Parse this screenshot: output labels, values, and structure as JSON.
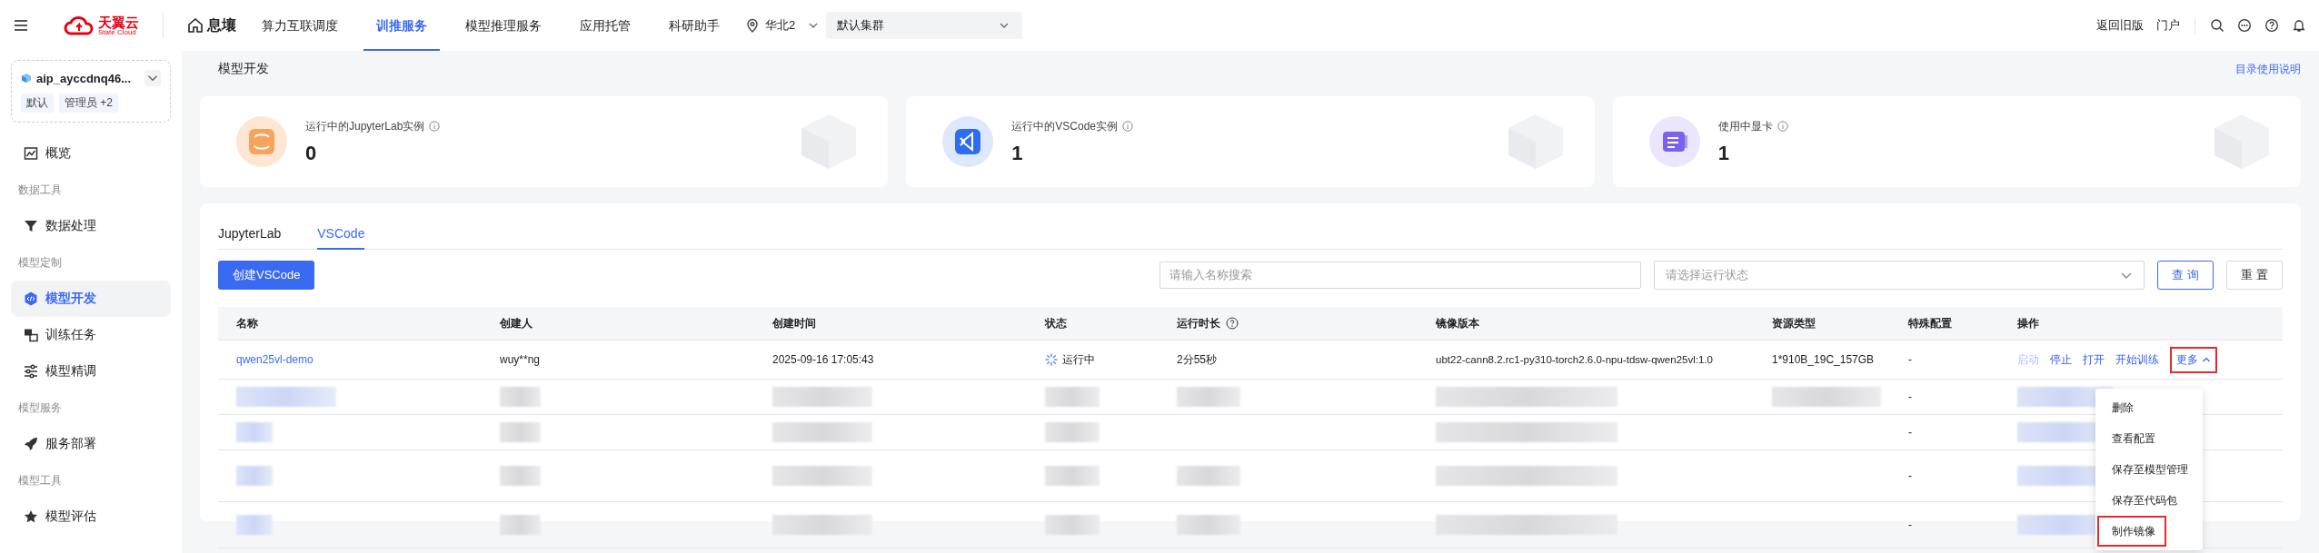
{
  "topbar": {
    "logo_text": "天翼云",
    "logo_sub": "State Cloud",
    "home_label": "息壤",
    "nav": [
      {
        "label": "算力互联调度",
        "selected": false
      },
      {
        "label": "训推服务",
        "selected": true
      },
      {
        "label": "模型推理服务",
        "selected": false
      },
      {
        "label": "应用托管",
        "selected": false
      },
      {
        "label": "科研助手",
        "selected": false
      }
    ],
    "region": "华北2",
    "cluster": "默认集群",
    "right_links": [
      "返回旧版",
      "门户"
    ]
  },
  "sidebar": {
    "workspace": {
      "name": "aip_ayccdnq46...",
      "tags": [
        "默认",
        "管理员 +2"
      ]
    },
    "entries": [
      {
        "kind": "item",
        "label": "概览",
        "selected": false
      },
      {
        "kind": "section",
        "label": "数据工具"
      },
      {
        "kind": "item",
        "label": "数据处理",
        "selected": false
      },
      {
        "kind": "section",
        "label": "模型定制"
      },
      {
        "kind": "item",
        "label": "模型开发",
        "selected": true
      },
      {
        "kind": "item",
        "label": "训练任务",
        "selected": false
      },
      {
        "kind": "item",
        "label": "模型精调",
        "selected": false
      },
      {
        "kind": "section",
        "label": "模型服务"
      },
      {
        "kind": "item",
        "label": "服务部署",
        "selected": false
      },
      {
        "kind": "section",
        "label": "模型工具"
      },
      {
        "kind": "item",
        "label": "模型评估",
        "selected": false
      }
    ]
  },
  "page": {
    "title": "模型开发",
    "help_link": "目录使用说明"
  },
  "stats": [
    {
      "label": "运行中的JupyterLab实例",
      "value": "0"
    },
    {
      "label": "运行中的VSCode实例",
      "value": "1"
    },
    {
      "label": "使用中显卡",
      "value": "1"
    }
  ],
  "tabs": [
    {
      "label": "JupyterLab",
      "selected": false
    },
    {
      "label": "VSCode",
      "selected": true
    }
  ],
  "create_button": "创建VSCode",
  "search": {
    "placeholder": "请输入名称搜索"
  },
  "status_filter": {
    "placeholder": "请选择运行状态"
  },
  "query_button": "查 询",
  "reset_button": "重 置",
  "table": {
    "columns": [
      "名称",
      "创建人",
      "创建时间",
      "状态",
      "运行时长",
      "镜像版本",
      "资源类型",
      "特殊配置",
      "操作"
    ],
    "rows": [
      {
        "name": "qwen25vl-demo",
        "creator": "wuy**ng",
        "created": "2025-09-16 17:05:43",
        "status": "运行中",
        "duration": "2分55秒",
        "image": "ubt22-cann8.2.rc1-py310-torch2.6.0-npu-tdsw-qwen25vl:1.0",
        "resource": "1*910B_19C_157GB",
        "special": "-",
        "actions": [
          {
            "label": "启动",
            "disabled": true
          },
          {
            "label": "停止",
            "disabled": false
          },
          {
            "label": "打开",
            "disabled": false
          },
          {
            "label": "开始训练",
            "disabled": false
          }
        ],
        "more": {
          "label": "更多",
          "expanded": true,
          "annotated": true
        }
      }
    ],
    "redacted_rows": [
      {
        "special": "-"
      },
      {
        "special": "-"
      },
      {
        "special": "-"
      },
      {
        "special": "-"
      }
    ]
  },
  "more_menu": [
    {
      "label": "删除",
      "annotated": false
    },
    {
      "label": "查看配置",
      "annotated": false
    },
    {
      "label": "保存至模型管理",
      "annotated": false
    },
    {
      "label": "保存至代码包",
      "annotated": false
    },
    {
      "label": "制作镜像",
      "annotated": true
    }
  ]
}
